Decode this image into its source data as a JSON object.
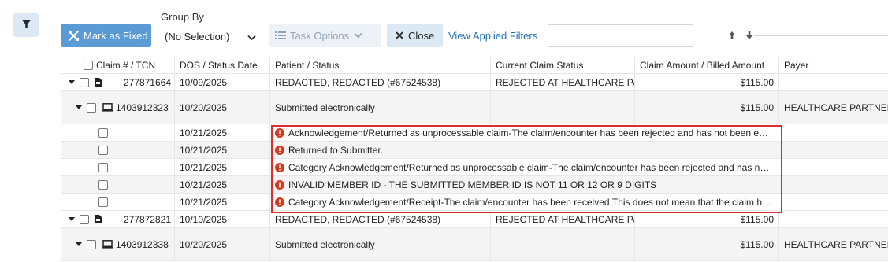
{
  "toolbar": {
    "mark_fixed_label": "Mark as Fixed",
    "group_by_label": "Group By",
    "group_by_value": "(No Selection)",
    "task_options_label": "Task Options",
    "close_label": "Close",
    "view_filters_label": "View Applied Filters",
    "search_value": ""
  },
  "columns": [
    "Claim # / TCN",
    "DOS / Status Date",
    "Patient / Status",
    "Current Claim Status",
    "Claim Amount / Billed Amount",
    "Payer"
  ],
  "rows": [
    {
      "claim": "277871664",
      "date": "10/09/2025",
      "patient": "REDACTED, REDACTED (#67524538)",
      "current_status": "REJECTED AT HEALTHCARE PA…",
      "amount": "$115.00",
      "payer": ""
    },
    {
      "claim": "1403912323",
      "date": "10/20/2025",
      "patient": "Submitted electronically",
      "current_status": "",
      "amount": "$115.00",
      "payer": "HEALTHCARE PARTNERS"
    },
    {
      "date": "10/21/2025",
      "patient": "Acknowledgement/Returned as unprocessable claim-The claim/encounter has been rejected and has not been e…"
    },
    {
      "date": "10/21/2025",
      "patient": "Returned to Submitter."
    },
    {
      "date": "10/21/2025",
      "patient": "Category Acknowledgement/Returned as unprocessable claim-The claim/encounter has been rejected and has n…"
    },
    {
      "date": "10/21/2025",
      "patient": "INVALID MEMBER ID - THE SUBMITTED MEMBER ID IS NOT 11 OR 12 OR 9 DIGITS"
    },
    {
      "date": "10/21/2025",
      "patient": "Category Acknowledgement/Receipt-The claim/encounter has been received.This does not mean that the claim h…"
    },
    {
      "claim": "277872821",
      "date": "10/10/2025",
      "patient": "REDACTED, REDACTED (#67524538)",
      "current_status": "REJECTED AT HEALTHCARE PA…",
      "amount": "$115.00",
      "payer": ""
    },
    {
      "claim": "1403912338",
      "date": "10/20/2025",
      "patient": "Submitted electronically",
      "current_status": "",
      "amount": "$115.00",
      "payer": "HEALTHCARE PARTNERS"
    }
  ],
  "colors": {
    "primary": "#5b9bd5",
    "error": "#d93a1f",
    "highlight": "#d92e2e"
  }
}
